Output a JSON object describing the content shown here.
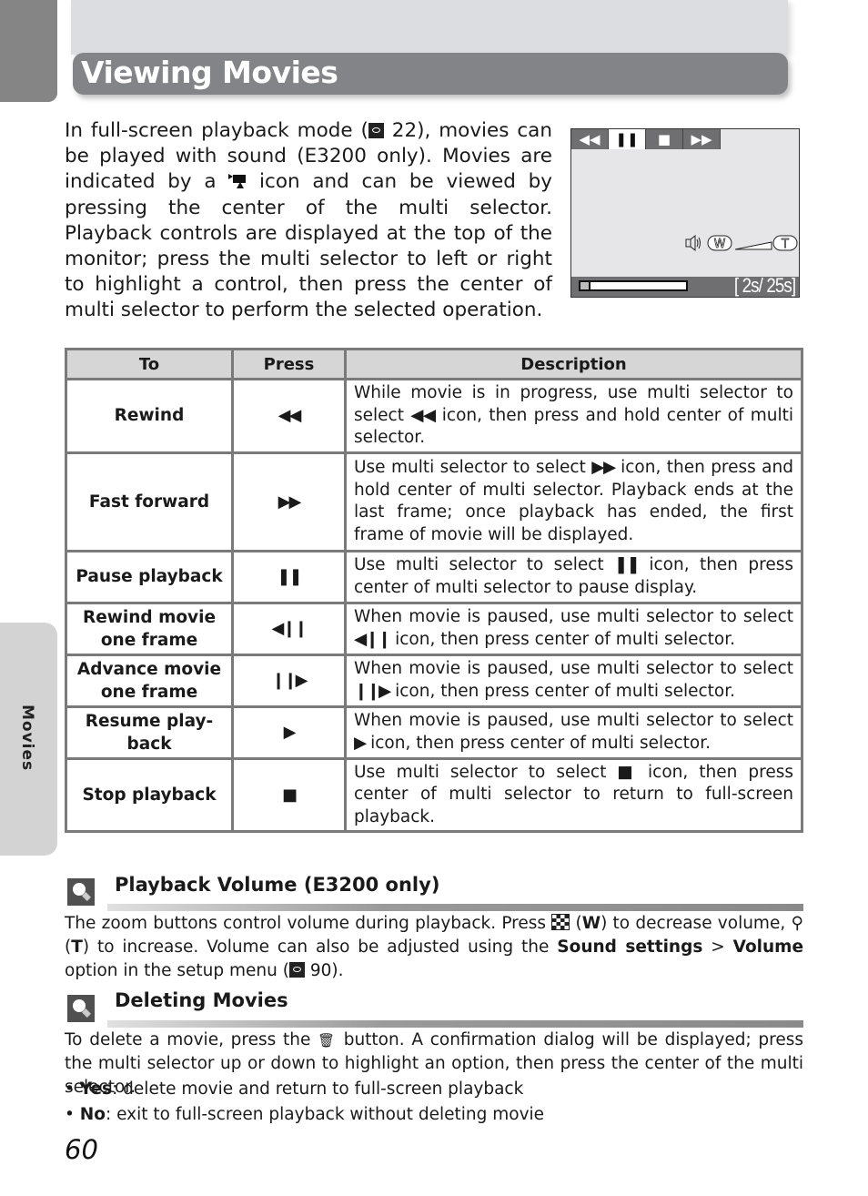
{
  "header": {
    "title": "Viewing Movies"
  },
  "side_tab": {
    "label": "Movies"
  },
  "intro": {
    "part1": "In full-screen playback mode (",
    "ref1": "22",
    "part2": "), movies can be played with sound (E3200 only). Movies are indicated by a ",
    "part3": " icon and can be viewed by pressing the center of the multi selector. Playback controls are displayed at the top of the monitor; press the multi selector to left or right to highlight a control, then press the center of multi selector to perform the selected operation."
  },
  "monitor": {
    "controls": [
      {
        "icon": "rewind-icon",
        "glyph": "◀◀",
        "selected": false
      },
      {
        "icon": "pause-icon",
        "glyph": "❚❚",
        "selected": true
      },
      {
        "icon": "stop-icon",
        "glyph": "■",
        "selected": false
      },
      {
        "icon": "fast-forward-icon",
        "glyph": "▶▶",
        "selected": false
      }
    ],
    "volume_w_label": "W",
    "volume_t_label": "T",
    "progress_fraction": 0.08,
    "time_readout": "[ 2s/ 25s]"
  },
  "table": {
    "headers": [
      "To",
      "Press",
      "Description"
    ],
    "rows": [
      {
        "to": "Rewind",
        "press": "◀◀",
        "desc_a": "While movie is in progress, use multi selector to select ",
        "desc_sym": "◀◀",
        "desc_b": " icon, then press and hold center of multi selector."
      },
      {
        "to": "Fast forward",
        "press": "▶▶",
        "desc_a": "Use multi selector to select ",
        "desc_sym": "▶▶",
        "desc_b": " icon, then press and hold center of multi selector. Playback ends at the last frame; once playback has ended, the first frame of movie will be displayed."
      },
      {
        "to": "Pause playback",
        "press": "❚❚",
        "desc_a": "Use multi selector to select ",
        "desc_sym": "❚❚",
        "desc_b": " icon, then press center of multi selector to pause display."
      },
      {
        "to": "Rewind movie one frame",
        "press": "◀❙❙",
        "desc_a": "When movie is paused, use multi selector to select ",
        "desc_sym": "◀❙❙",
        "desc_b": " icon, then press center of multi selector."
      },
      {
        "to": "Advance movie one frame",
        "press": "❙❙▶",
        "desc_a": "When movie is paused, use multi selector to select ",
        "desc_sym": "❙❙▶",
        "desc_b": " icon, then press center of multi selector."
      },
      {
        "to": "Resume play-back",
        "press": "▶",
        "desc_a": "When movie is paused, use multi selector to select ",
        "desc_sym": "▶",
        "desc_b": " icon, then press center of multi selector."
      },
      {
        "to": "Stop playback",
        "press": "■",
        "desc_a": "Use multi selector to select ",
        "desc_sym": "■",
        "desc_b": " icon, then press center of multi selector to return to full-screen playback."
      }
    ]
  },
  "volume_section": {
    "title": "Playback Volume (E3200 only)",
    "t1": "The zoom buttons control volume during playback. Press ",
    "w_paren_open": " (",
    "w_key": "W",
    "t2": ") to decrease volume, ",
    "t_key_glyph": "⚲",
    "t_paren_open": " (",
    "t_key": "T",
    "t3": ") to increase. Volume can also be adjusted using the ",
    "b1": "Sound settings",
    "t4": " > ",
    "b2": "Volume",
    "t5": " option in the setup menu (",
    "ref": "90",
    "t6": ")."
  },
  "delete_section": {
    "title": "Deleting Movies",
    "t1": "To delete a movie, press the ",
    "trash_glyph": "🗑",
    "t2": " button. A confirmation dialog will be displayed; press the multi selector up or down to highlight an option, then press the center of the multi selector.",
    "bullets": [
      {
        "key": "Yes",
        "text": ": delete movie and return to full-screen playback"
      },
      {
        "key": "No",
        "text": ": exit to full-screen playback without deleting movie"
      }
    ]
  },
  "page_number": "60"
}
